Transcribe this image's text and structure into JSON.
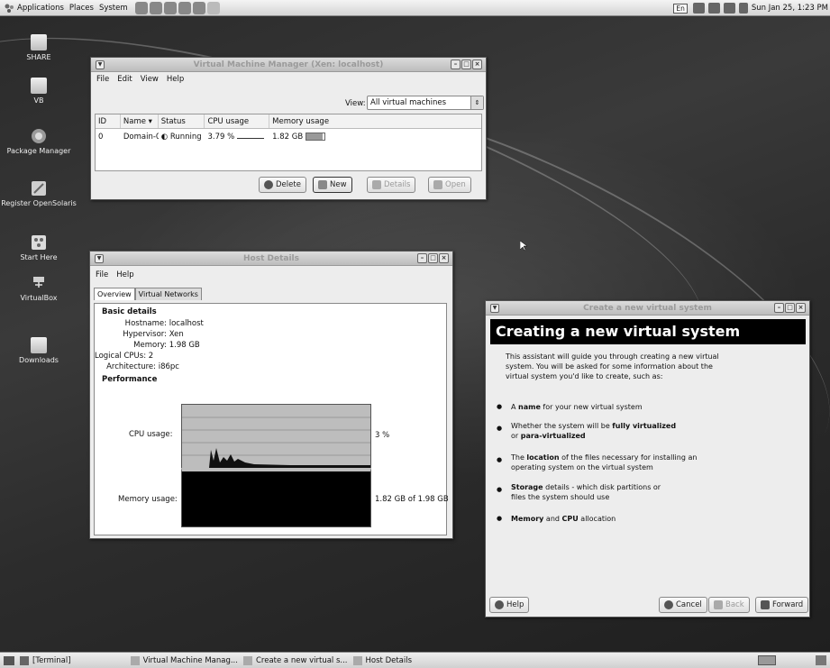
{
  "top_panel": {
    "menus": [
      "Applications",
      "Places",
      "System"
    ],
    "lang": "En",
    "clock": "Sun Jan 25,  1:23 PM"
  },
  "desktop_icons": [
    {
      "label": "SHARE",
      "icon": "folder-icon"
    },
    {
      "label": "VB",
      "icon": "folder-icon"
    },
    {
      "label": "Package Manager",
      "icon": "package-manager-icon"
    },
    {
      "label": "Register OpenSolaris",
      "icon": "register-icon"
    },
    {
      "label": "Start Here",
      "icon": "start-here-icon"
    },
    {
      "label": "VirtualBox",
      "icon": "virtualbox-icon"
    },
    {
      "label": "Downloads",
      "icon": "folder-icon"
    }
  ],
  "vmm": {
    "title": "Virtual Machine Manager (Xen: localhost)",
    "menus": [
      "File",
      "Edit",
      "View",
      "Help"
    ],
    "view_label": "View:",
    "view_value": "All virtual machines",
    "columns": [
      "ID",
      "Name",
      "Status",
      "CPU usage",
      "Memory usage"
    ],
    "rows": [
      {
        "id": "0",
        "name": "Domain-0",
        "status": "Running",
        "cpu": "3.79 %",
        "mem": "1.82 GB",
        "mem_fraction": 0.92
      }
    ],
    "buttons": {
      "delete": "Delete",
      "new": "New",
      "details": "Details",
      "open": "Open"
    }
  },
  "host": {
    "title": "Host Details",
    "menus": [
      "File",
      "Help"
    ],
    "tabs": [
      "Overview",
      "Virtual Networks"
    ],
    "basic_title": "Basic details",
    "hostname_label": "Hostname:",
    "hostname": "localhost",
    "hypervisor_label": "Hypervisor:",
    "hypervisor": "Xen",
    "memory_label": "Memory:",
    "memory": "1.98 GB",
    "cpus_label": "Logical CPUs:",
    "cpus": "2",
    "arch_label": "Architecture:",
    "arch": "i86pc",
    "perf_title": "Performance",
    "cpu_label": "CPU usage:",
    "cpu_value": "3 %",
    "mem_label": "Memory usage:",
    "mem_value": "1.82 GB of 1.98 GB"
  },
  "wizard": {
    "window_title": "Create a new virtual system",
    "header": "Creating a new virtual system",
    "intro": "This assistant will guide you through creating a new virtual system. You will be asked for some information about the virtual system you'd like to create, such as:",
    "bullets": [
      {
        "pre": "A ",
        "bold": "name",
        "post": " for your new virtual system"
      },
      {
        "pre": "Whether the system will be ",
        "bold": "fully virtualized",
        "post": " or ",
        "bold2": "para-virtualized"
      },
      {
        "pre": "The ",
        "bold": "location",
        "post": " of the files necessary for installing an operating system on the virtual system"
      },
      {
        "pre": "",
        "bold": "Storage",
        "post": " details - which disk partitions or files the system should use"
      },
      {
        "pre": "",
        "bold": "Memory",
        "post": " and ",
        "bold2": "CPU",
        "post2": " allocation"
      }
    ],
    "buttons": {
      "help": "Help",
      "cancel": "Cancel",
      "back": "Back",
      "forward": "Forward"
    }
  },
  "taskbar": {
    "items": [
      "[Terminal]",
      "Virtual Machine Manag...",
      "Create a new virtual s...",
      "Host Details"
    ]
  }
}
